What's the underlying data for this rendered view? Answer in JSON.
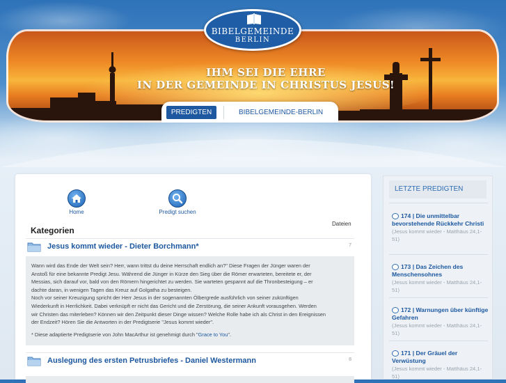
{
  "brand": {
    "line1": "BIBELGEMEINDE",
    "line2": "BERLIN"
  },
  "banner": {
    "line1": "IHM SEI DIE EHRE",
    "line2": "IN DER GEMEINDE IN CHRISTUS JESUS!"
  },
  "nav": {
    "items": [
      {
        "label": "PREDIGTEN"
      },
      {
        "label": "BIBELGEMEINDE-BERLIN"
      }
    ]
  },
  "tools": {
    "home": "Home",
    "search": "Predigt suchen"
  },
  "content": {
    "heading": "Kategorien",
    "files_header": "Dateien",
    "categories": [
      {
        "title": "Jesus kommt wieder - Dieter Borchmann*",
        "count": "7",
        "description": [
          "Wann wird das Ende der Welt sein? Herr, wann trittst du deine Herrschaft endlich an?\" Diese Fragen der Jünger waren der",
          "Anstoß für eine bekannte Predigt Jesu. Während die Jünger in Kürze den Sieg über die Römer erwarteten, bereitete er, der",
          "Messias, sich darauf vor, bald von den Römern hingerichtet zu werden. Sie warteten gespannt auf die Thronbesteigung – er",
          "dachte daran, in wenigen Tagen das Kreuz auf Golgatha zu besteigen.",
          "Noch vor seiner Kreuzigung spricht der Herr Jesus in der sogenannten Ölbergrede ausführlich von seiner zukünftigen",
          "Wiederkunft in Herrlichkeit. Dabei verknüpft er nicht das Gericht und die Zerstörung, die seiner Ankunft vorausgehen. Werden",
          "wir Christen das miterleben? Können wir den Zeitpunkt dieser Dinge wissen? Welche Rolle habe ich als Christ in den Ereignissen",
          "der Endzeit? Hören Sie die Antworten in der Predigtserie \"Jesus kommt wieder\"."
        ],
        "note_prefix": "* Diese adaptierte Predigtserie von John MacArthur ist genehmigt durch \"",
        "note_link": "Grace to You",
        "note_suffix": "\"."
      },
      {
        "title": "Auslegung des ersten Petrusbriefes - Daniel Westermann",
        "count": "8"
      }
    ]
  },
  "sidebar": {
    "heading": "LETZTE PREDIGTEN",
    "items": [
      {
        "title": "174 | Die unmittelbar bevorstehende Rückkehr Christi",
        "sub": "(Jesus kommt wieder - Matthäus 24,1-51)"
      },
      {
        "title": "173 | Das Zeichen des Menschensohnes",
        "sub": "(Jesus kommt wieder - Matthäus 24,1-51)"
      },
      {
        "title": "172 | Warnungen über künftige Gefahren",
        "sub": "(Jesus kommt wieder - Matthäus 24,1-51)"
      },
      {
        "title": "171 | Der Gräuel der Verwüstung",
        "sub": "(Jesus kommt wieder - Matthäus 24,1-51)"
      }
    ]
  },
  "colors": {
    "brand_blue": "#1d58a0",
    "link_blue": "#2f6db3",
    "banner_orange": "#ef8a26"
  }
}
